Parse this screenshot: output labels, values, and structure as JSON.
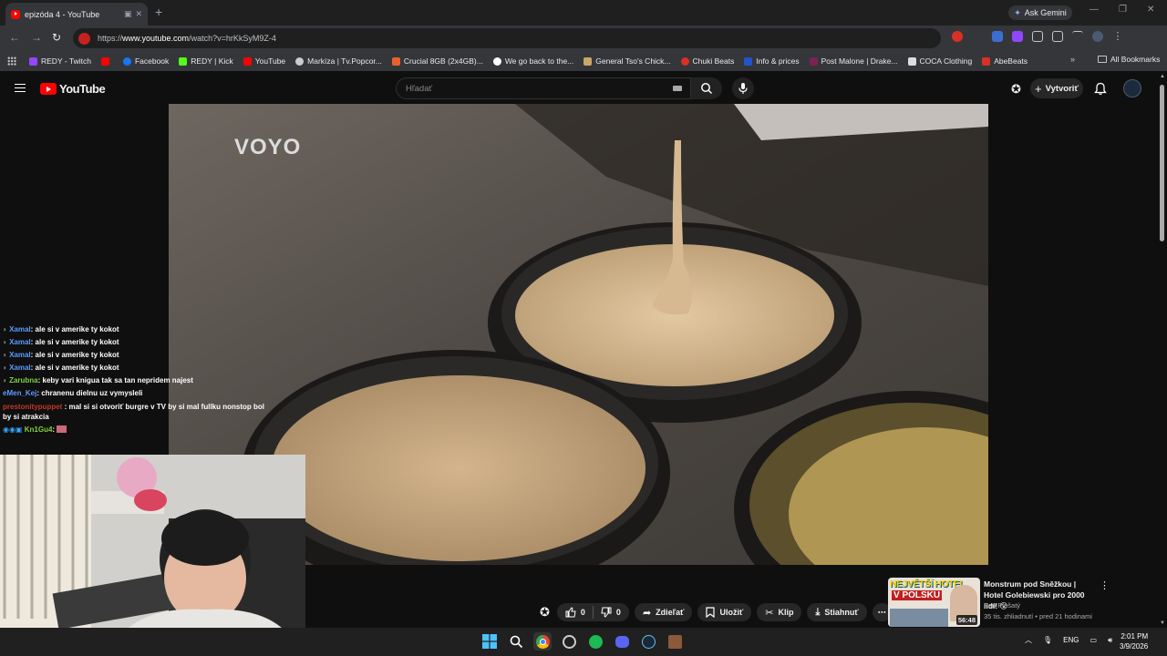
{
  "browser": {
    "tab_title": "epizóda 4 - YouTube",
    "new_tab": "+",
    "ask_gemini": "Ask Gemini",
    "url_prefix": "https://",
    "url_host": "www.youtube.com",
    "url_path": "/watch?v=hrKkSyM9Z-4",
    "all_bookmarks": "All Bookmarks",
    "bookmarks": [
      {
        "label": "REDY - Twitch",
        "color": "#9146ff"
      },
      {
        "label": "",
        "color": "#ff0000"
      },
      {
        "label": "Facebook",
        "color": "#1877f2"
      },
      {
        "label": "REDY | Kick",
        "color": "#53fc18"
      },
      {
        "label": "YouTube",
        "color": "#ff0000"
      },
      {
        "label": "Markíza | Tv.Popcor...",
        "color": "#cccccc"
      },
      {
        "label": "Crucial 8GB (2x4GB)...",
        "color": "#e8612c"
      },
      {
        "label": "We go back to the...",
        "color": "#ffffff"
      },
      {
        "label": "General Tso's Chick...",
        "color": "#c9a86a"
      },
      {
        "label": "Chuki Beats",
        "color": "#d93025"
      },
      {
        "label": "Info & prices",
        "color": "#2255cc"
      },
      {
        "label": "Post Malone | Drake...",
        "color": "#7a2255"
      },
      {
        "label": "COCA Clothing",
        "color": "#dddddd"
      },
      {
        "label": "AbeBeats",
        "color": "#d93025"
      }
    ]
  },
  "youtube": {
    "logo_text": "YouTube",
    "search_placeholder": "Hľadať",
    "create_label": "Vytvoriť",
    "watermark": "VOYO"
  },
  "chat": [
    {
      "user": "Xamal",
      "user_color": "#5b9bff",
      "text": ": ale si v amerike ty kokot"
    },
    {
      "user": "Xamal",
      "user_color": "#5b9bff",
      "text": ": ale si v amerike ty kokot"
    },
    {
      "user": "Xamal",
      "user_color": "#5b9bff",
      "text": ": ale si v amerike ty kokot"
    },
    {
      "user": "Xamal",
      "user_color": "#5b9bff",
      "text": ": ale si v amerike ty kokot"
    },
    {
      "user": "Zarubna",
      "user_color": "#7fd13b",
      "text": ": keby vari knigua tak sa tan nepridem najest"
    },
    {
      "user": "eMen_Kej",
      "user_color": "#5b9bff",
      "text": ": chranenu dielnu uz vymysleli"
    },
    {
      "user": "prestonitypuppet",
      "user_color": "#c0392b",
      "text": ": mal si si otvoriť burgre v TV by si mal fullku nonstop bol by si atrakcia"
    },
    {
      "user": "Kn1Gu4",
      "user_color": "#7fd13b",
      "text": ":"
    }
  ],
  "actions": {
    "like_count": "0",
    "dislike_count": "0",
    "share": "Zdieľať",
    "save": "Uložiť",
    "clip": "Klip",
    "download": "Stiahnuť",
    "more": "⋯"
  },
  "recommended": {
    "title": "Monstrum pod Sněžkou | Hotel Golebiewski pro 2000 lidí! 😮",
    "channel": "Pan Plešatý",
    "meta": "35 tis. zhliadnutí • pred 21 hodinami",
    "duration": "56:48",
    "thumb_text_1": "NEJVĚTŠÍ HOTEL",
    "thumb_text_2": "V POLSKU"
  },
  "taskbar": {
    "lang": "ENG",
    "time": "2:01 PM",
    "date": "3/9/2026"
  }
}
